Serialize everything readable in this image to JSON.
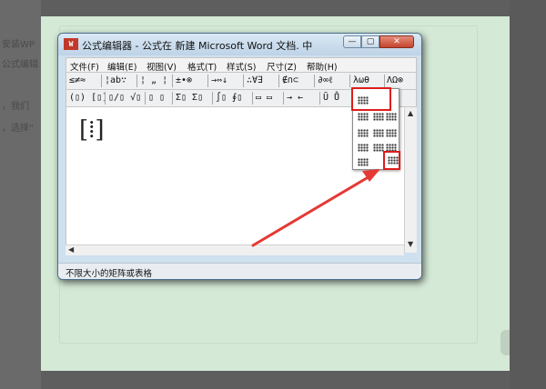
{
  "background": {
    "snippets": [
      "安装WP",
      "公式编辑",
      "，我们",
      "，选择“"
    ]
  },
  "window": {
    "icon_text": "W",
    "title": "公式编辑器 - 公式在 新建 Microsoft Word 文档. 中",
    "controls": {
      "minimize": "—",
      "maximize": "▢",
      "close": "✕"
    }
  },
  "menu": {
    "items": [
      "文件(F)",
      "编辑(E)",
      "视图(V)",
      "格式(T)",
      "样式(S)",
      "尺寸(Z)",
      "帮助(H)"
    ]
  },
  "toolbar_row1": {
    "groups": [
      "≤≠≈",
      "¦ab∵",
      "¦ „ ¦",
      "±•⊗",
      "→⇔↓",
      "∴∀∃",
      "∉∩⊂",
      "∂∞ℓ",
      "λωθ",
      "ΛΩ⊗"
    ]
  },
  "toolbar_row2": {
    "groups": [
      "(▯) [▯]",
      "▯/▯ √▯",
      "▯ ▯",
      "Σ▯ Σ▯",
      "∫▯ ∮▯",
      "▭ ▭",
      "→ ←",
      "Ũ Ů"
    ]
  },
  "editor": {
    "content": "[⁞]"
  },
  "popup": {
    "rows": 5
  },
  "status": {
    "text": "不限大小的矩阵或表格"
  },
  "colors": {
    "highlight": "#e01c1c",
    "arrow": "#e53935",
    "page_background": "#d4e9d6"
  }
}
